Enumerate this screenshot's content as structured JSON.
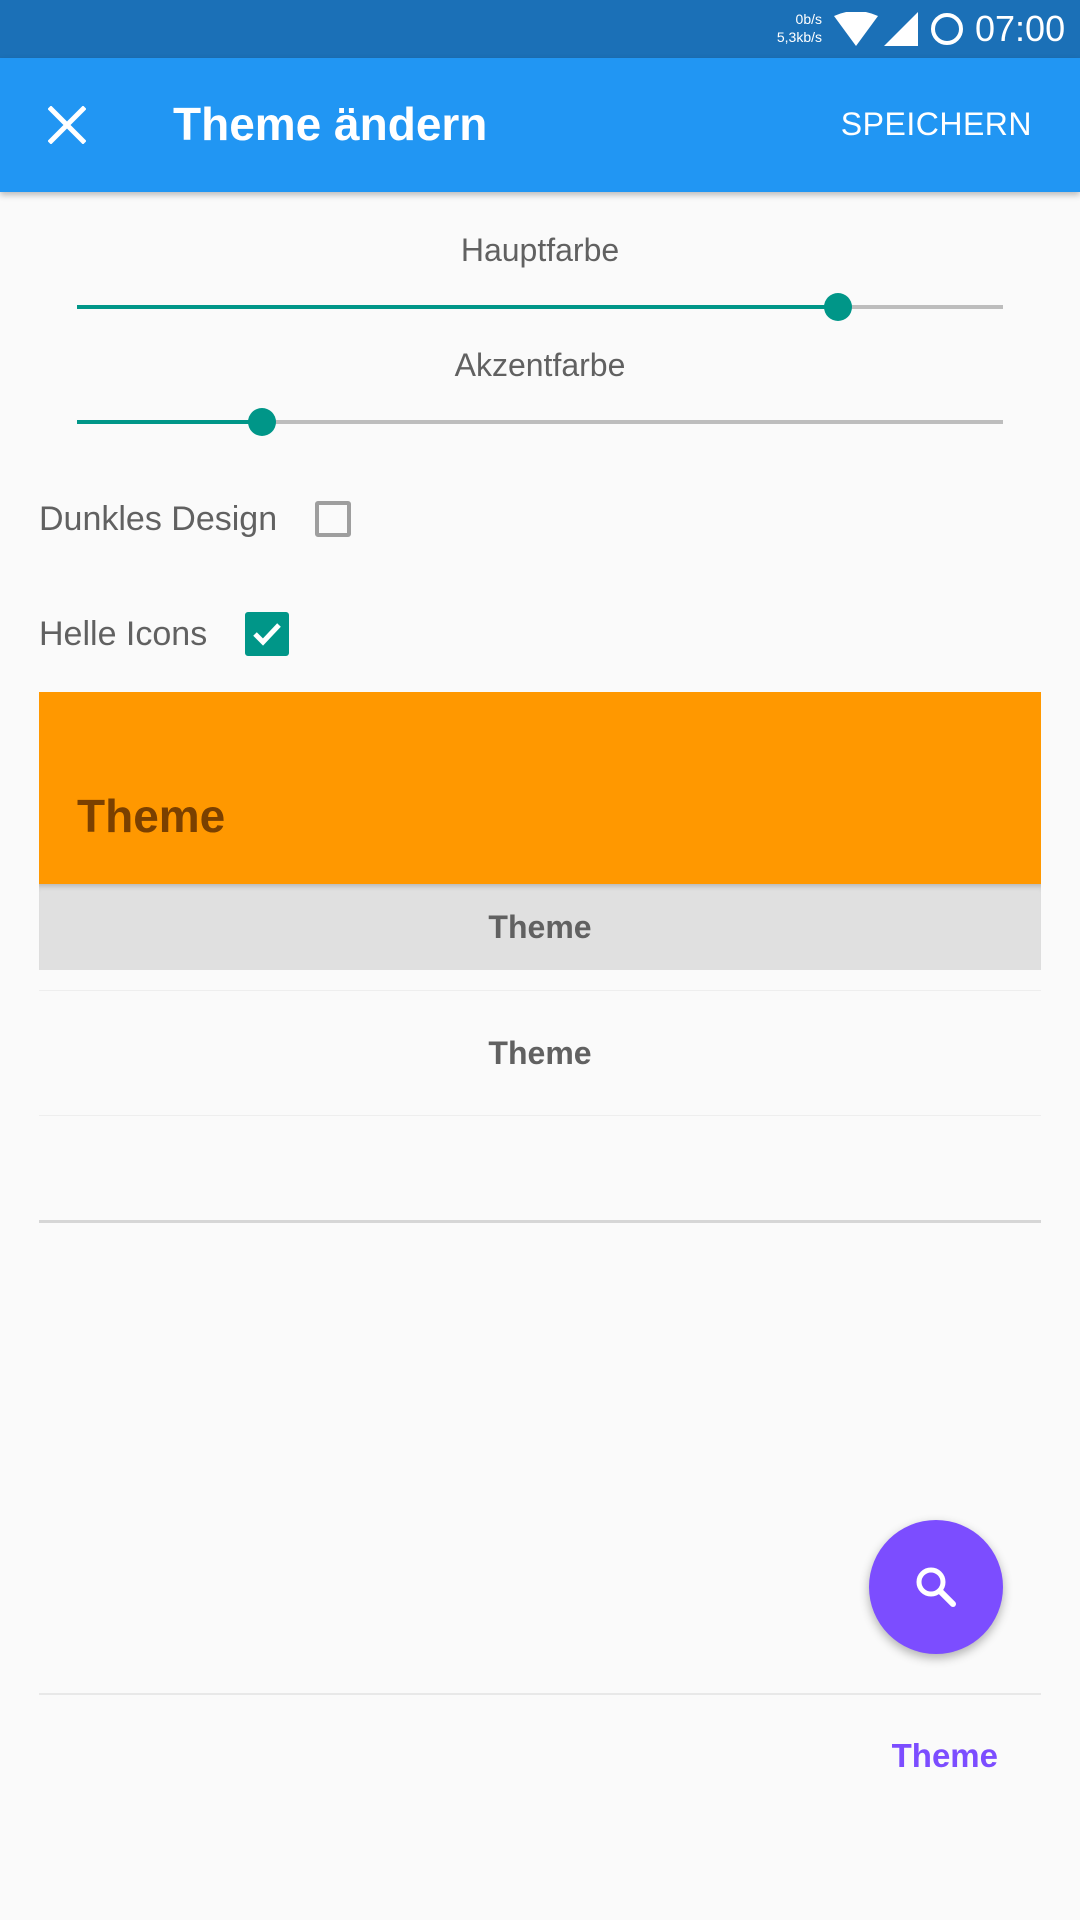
{
  "status_bar": {
    "upload_speed": "0b/s",
    "download_speed": "5,3kb/s",
    "time": "07:00",
    "background": "#1b70b7",
    "icons": [
      "wifi-icon",
      "cell-signal-icon",
      "ring-icon"
    ]
  },
  "app_bar": {
    "title": "Theme ändern",
    "action_label": "SPEICHERN",
    "close_icon": "close-icon",
    "background": "#2196f3"
  },
  "sliders": {
    "primary": {
      "label": "Hauptfarbe",
      "value": 0.822
    },
    "accent": {
      "label": "Akzentfarbe",
      "value": 0.2
    },
    "color": "#009688"
  },
  "options": {
    "dark_design": {
      "label": "Dunkles Design",
      "checked": false
    },
    "light_icons": {
      "label": "Helle Icons",
      "checked": true
    }
  },
  "preview": {
    "header_title": "Theme",
    "tab_label": "Theme",
    "item_label": "Theme",
    "link_label": "Theme",
    "primary_color": "#ff9800",
    "accent_color": "#7c4dff",
    "fab_icon": "search-icon"
  }
}
